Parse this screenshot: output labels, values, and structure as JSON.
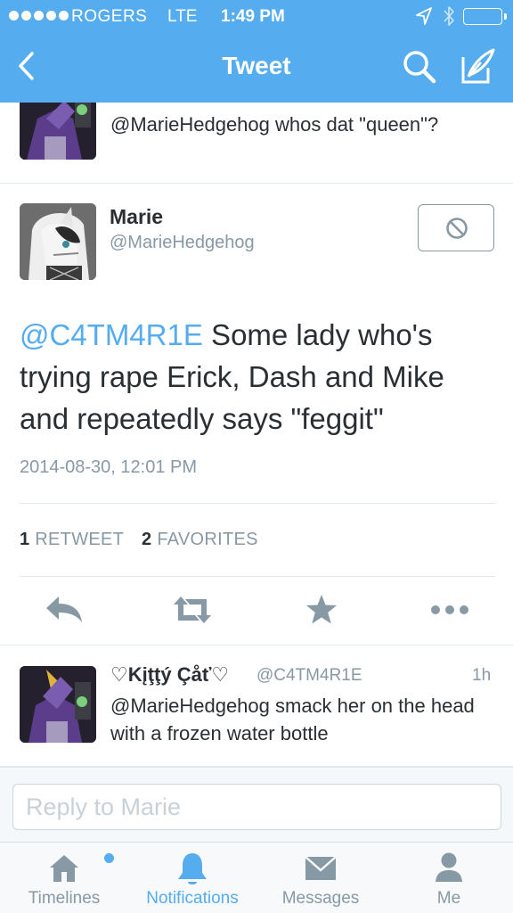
{
  "status_bar": {
    "carrier": "ROGERS",
    "network": "LTE",
    "time": "1:49 PM"
  },
  "nav": {
    "title": "Tweet"
  },
  "previous_tweet": {
    "text": "@MarieHedgehog whos dat \"queen\"?"
  },
  "tweet": {
    "author_name": "Marie",
    "author_handle": "@MarieHedgehog",
    "mention": "@C4TM4R1E",
    "body": " Some lady who's trying rape Erick, Dash and Mike and repeatedly says \"feggit\"",
    "timestamp": "2014-08-30, 12:01 PM",
    "retweet_count": "1",
    "retweet_label": "RETWEET",
    "favorite_count": "2",
    "favorite_label": "FAVORITES"
  },
  "reply": {
    "author_name": "♡Kįţţý Çåť♡",
    "author_handle": "@C4TM4R1E",
    "age": "1h",
    "text": "@MarieHedgehog smack her on the head with a frozen water bottle"
  },
  "reply_box": {
    "placeholder": "Reply to Marie"
  },
  "tabs": [
    {
      "label": "Timelines",
      "icon": "home-icon"
    },
    {
      "label": "Notifications",
      "icon": "bell-icon"
    },
    {
      "label": "Messages",
      "icon": "envelope-icon"
    },
    {
      "label": "Me",
      "icon": "person-icon"
    }
  ],
  "colors": {
    "accent": "#55acee",
    "muted_text": "#8899a6",
    "body_text": "#292f33"
  }
}
